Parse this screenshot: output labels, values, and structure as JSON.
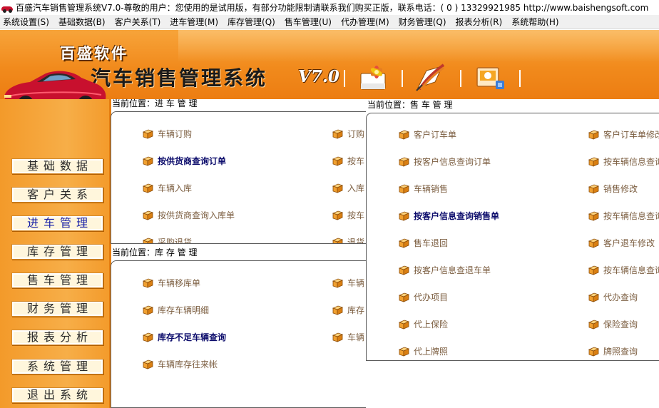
{
  "window": {
    "title": "百盛汽车销售管理系统V7.0-尊敬的用户：您使用的是试用版，有部分功能限制请联系我们购买正版，联系电话：( 0 ) 13329921985  http://www.baishengsoft.com"
  },
  "menubar": [
    "系统设置(S)",
    "基础数据(B)",
    "客户关系(T)",
    "进车管理(M)",
    "库存管理(Q)",
    "售车管理(U)",
    "代办管理(M)",
    "财务管理(Q)",
    "报表分析(R)",
    "系统帮助(H)"
  ],
  "banner": {
    "brand": "百盛软件",
    "product": "汽车销售管理系统",
    "version": "V7.0",
    "toolbar_icons": [
      "flower-document-icon",
      "quill-pen-icon",
      "presentation-icon"
    ]
  },
  "sidebar": {
    "items": [
      "基础数据",
      "客户关系",
      "进车管理",
      "库存管理",
      "售车管理",
      "财务管理",
      "报表分析",
      "系统管理",
      "退出系统"
    ],
    "active_index": 2
  },
  "panels": {
    "purchase": {
      "label": "当前位置：进 车 管 理",
      "col1": [
        "车辆订购",
        "按供货商查询订单",
        "车辆入库",
        "按供货商查询入库单",
        "采购退货"
      ],
      "col2": [
        "订购",
        "按车",
        "入库",
        "按车",
        "退货"
      ],
      "bold": [
        "按供货商查询订单"
      ]
    },
    "inventory": {
      "label": "当前位置：库 存 管 理",
      "col1": [
        "车辆移库单",
        "库存车辆明细",
        "库存不足车辆查询",
        "车辆库存往来帐"
      ],
      "col2": [
        "车辆",
        "库存",
        "车辆"
      ],
      "bold": [
        "库存不足车辆查询"
      ]
    },
    "sales": {
      "label": "当前位置：售 车 管 理",
      "col1": [
        "客户订车单",
        "按客户信息查询订单",
        "车辆销售",
        "按客户信息查询销售单",
        "售车退回",
        "按客户信息查退车单",
        "代办项目",
        "代上保险",
        "代上牌照"
      ],
      "col2": [
        "客户订车单修改",
        "按车辆信息查询",
        "销售修改",
        "按车辆信息查询",
        "客户退车修改",
        "按车辆信息查询",
        "代办查询",
        "保险查询",
        "牌照查询"
      ],
      "bold": [
        "按客户信息查询销售单"
      ]
    }
  },
  "colors": {
    "banner": "#f18a1c",
    "sidebar": "#f7ae48",
    "item_text": "#7b5d3f",
    "item_bold": "#0b0b6b",
    "active_nav": "#1a22a8"
  }
}
